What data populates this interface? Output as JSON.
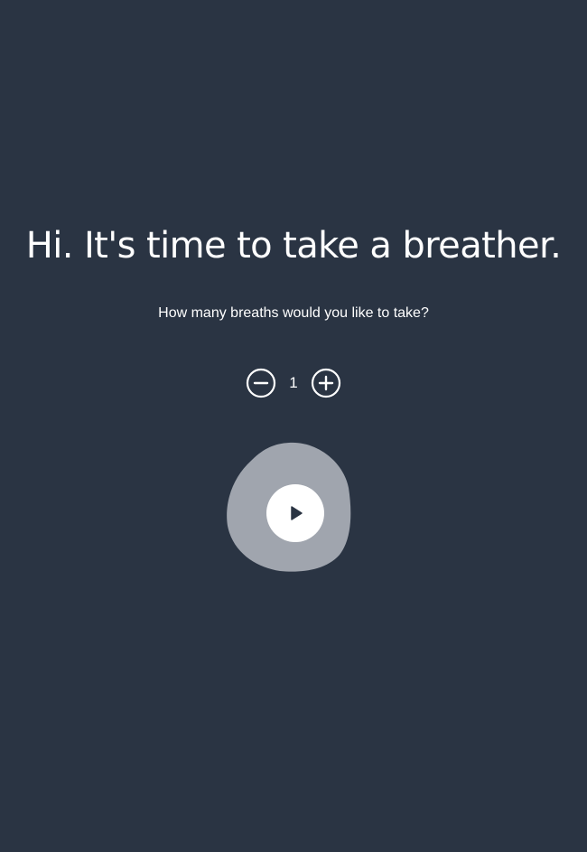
{
  "page": {
    "background_color": "#2a3443"
  },
  "greeting": {
    "headline": "Hi. It's time to take a breather."
  },
  "prompt": {
    "question": "How many breaths would you like to take?"
  },
  "breath_counter": {
    "value": "1",
    "decrement_icon": "minus-circle-icon",
    "increment_icon": "plus-circle-icon"
  },
  "start": {
    "play_icon": "play-icon",
    "blob_color": "#a0a5ae",
    "button_color": "#ffffff"
  }
}
